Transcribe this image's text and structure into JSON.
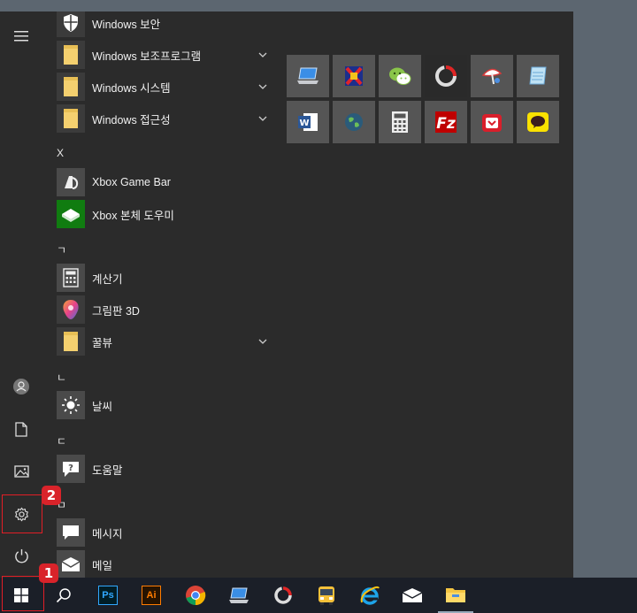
{
  "apps": [
    {
      "label": "Windows 보안",
      "icon": "shield-icon",
      "chevron": false
    },
    {
      "label": "Windows 보조프로그램",
      "icon": "folder-icon",
      "chevron": true
    },
    {
      "label": "Windows 시스템",
      "icon": "folder-icon",
      "chevron": true
    },
    {
      "label": "Windows 접근성",
      "icon": "folder-icon",
      "chevron": true
    },
    {
      "label": "Xbox Game Bar",
      "icon": "xbox-game-bar-icon",
      "chevron": false
    },
    {
      "label": "Xbox 본체 도우미",
      "icon": "xbox-console-icon",
      "chevron": false
    },
    {
      "label": "계산기",
      "icon": "calculator-icon",
      "chevron": false
    },
    {
      "label": "그림판 3D",
      "icon": "paint3d-icon",
      "chevron": false
    },
    {
      "label": "꿀뷰",
      "icon": "folder-icon",
      "chevron": true
    },
    {
      "label": "날씨",
      "icon": "weather-icon",
      "chevron": false
    },
    {
      "label": "도움말",
      "icon": "help-icon",
      "chevron": false
    },
    {
      "label": "메시지",
      "icon": "messaging-icon",
      "chevron": false
    },
    {
      "label": "메일",
      "icon": "mail-icon",
      "chevron": false
    }
  ],
  "letters": [
    "X",
    "ㄱ",
    "ㄴ",
    "ㄷ",
    "ㅁ"
  ],
  "tiles": [
    {
      "icon": "this-pc-icon"
    },
    {
      "icon": "red-app-icon"
    },
    {
      "icon": "wechat-icon"
    },
    {
      "icon": "circle-app-icon"
    },
    {
      "icon": "satellite-icon"
    },
    {
      "icon": "notepad-icon"
    },
    {
      "icon": "word-icon"
    },
    {
      "icon": "globe-icon"
    },
    {
      "icon": "calculator-icon"
    },
    {
      "icon": "filezilla-icon"
    },
    {
      "icon": "red-suitcase-icon"
    },
    {
      "icon": "kakaotalk-icon"
    }
  ],
  "rail": [
    "menu-icon",
    "user-icon",
    "document-icon",
    "pictures-icon",
    "settings-icon",
    "power-icon"
  ],
  "taskbar": {
    "ps_label": "Ps",
    "ai_label": "Ai",
    "items": [
      "start-icon",
      "search-icon",
      "photoshop-icon",
      "illustrator-icon",
      "chrome-icon",
      "laptop-icon",
      "circle-app-icon",
      "bus-icon",
      "ie-icon",
      "mail-icon",
      "explorer-icon"
    ]
  },
  "annotations": [
    {
      "number": "1",
      "target": "start-button"
    },
    {
      "number": "2",
      "target": "settings-button"
    }
  ],
  "colors": {
    "accent": "#e21e26",
    "menu_bg": "#2b2b2b",
    "taskbar_bg": "#1b1f28",
    "desktop": "#5c6670"
  }
}
